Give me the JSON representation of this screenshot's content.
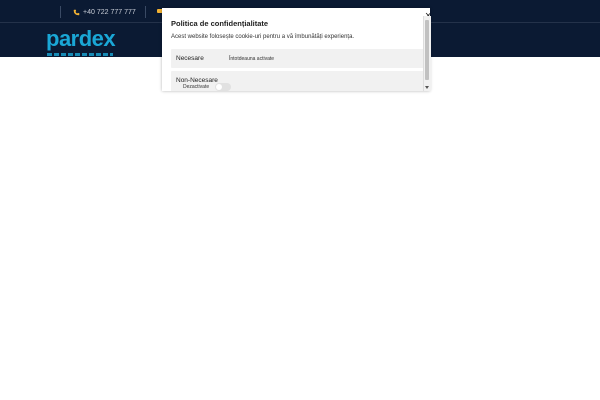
{
  "header": {
    "phone": "+40 722 777 777",
    "logo_text": "pardex",
    "brand_color": "#1aa7d6",
    "background_color": "#0b1a33",
    "icons": {
      "phone": "phone-icon",
      "mail": "mail-icon"
    }
  },
  "cookie_modal": {
    "title": "Politica de confidențialitate",
    "description": "Acest website folosește cookie-uri pentru a vă îmbunătăți experiența.",
    "close_icon": "×",
    "categories": [
      {
        "label": "Necesare",
        "status": "Întotdeauna activate"
      },
      {
        "label": "Non-Necesare",
        "status": "Dezactivate",
        "enabled": false
      }
    ]
  }
}
